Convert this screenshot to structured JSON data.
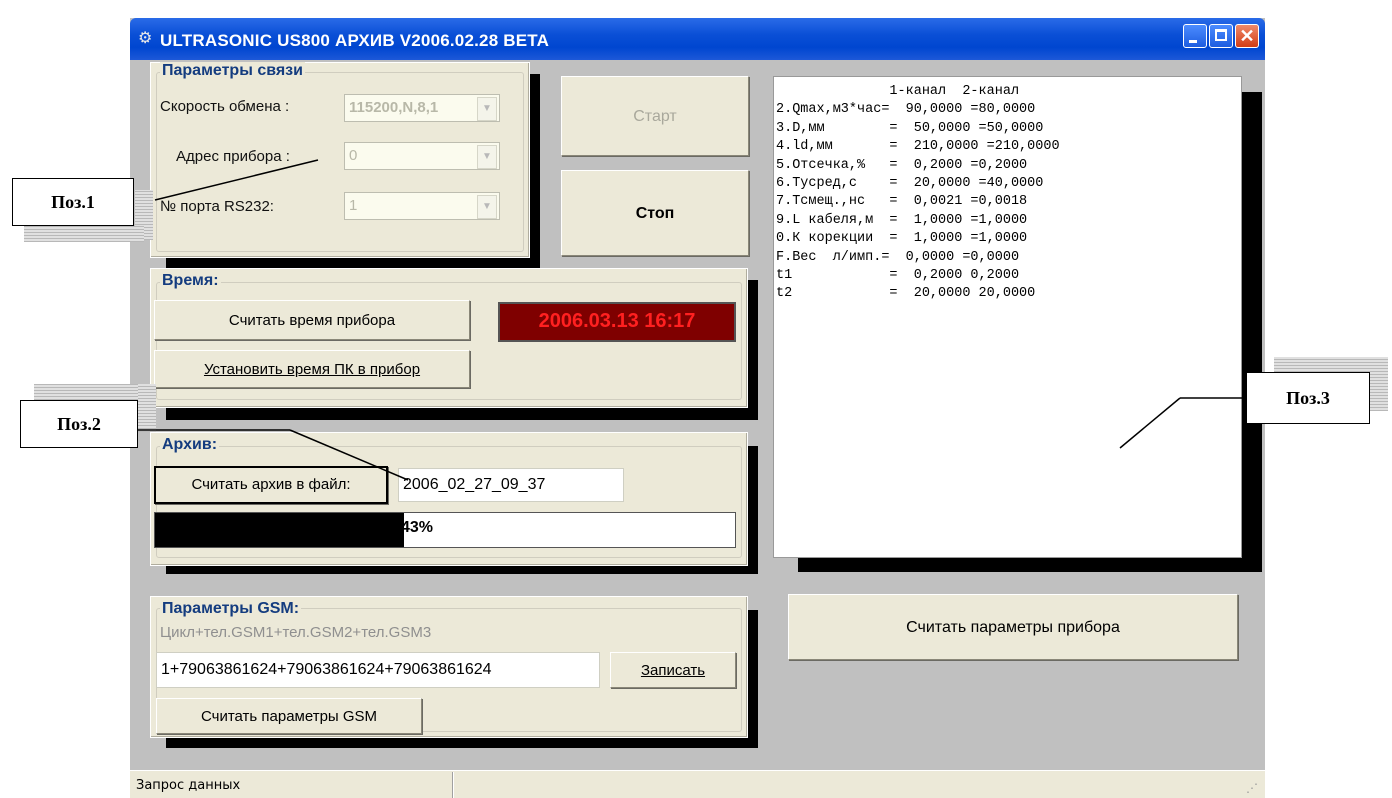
{
  "window": {
    "title": "ULTRASONIC US800 АРХИВ V2006.02.28 BETA",
    "controls": [
      "minimize",
      "maximize",
      "close"
    ]
  },
  "connection": {
    "legend": "Параметры связи",
    "baud_label": "Скорость обмена :",
    "baud_value": "115200,N,8,1",
    "address_label": "Адрес прибора :",
    "address_value": "0",
    "port_label": "№ порта RS232:",
    "port_value": "1"
  },
  "buttons": {
    "start": "Старт",
    "stop": "Стоп",
    "read_params": "Считать параметры прибора"
  },
  "time": {
    "legend": "Время:",
    "read_button": "Считать время прибора",
    "set_button": "Установить время ПК в прибор",
    "clock": "2006.03.13 16:17"
  },
  "archive": {
    "legend": "Архив:",
    "read_button": "Считать архив в файл:",
    "filename": "2006_02_27_09_37",
    "progress_percent": 43,
    "progress_text": "43%"
  },
  "gsm": {
    "legend": "Параметры GSM:",
    "hint": "Цикл+тел.GSM1+тел.GSM2+тел.GSM3",
    "value": "1+79063861624+79063861624+79063861624",
    "write_button": "Записать",
    "read_button": "Считать параметры GSM"
  },
  "params_text": [
    "              1-канал  2-канал",
    "2.Qmax,м3*час=  90,0000 =80,0000",
    "3.D,мм        =  50,0000 =50,0000",
    "4.ld,мм       =  210,0000 =210,0000",
    "5.Отсечка,%   =  0,2000 =0,2000",
    "6.Тусред,с    =  20,0000 =40,0000",
    "7.Тсмещ.,нс   =  0,0021 =0,0018",
    "9.L кабеля,м  =  1,0000 =1,0000",
    "0.К корекции  =  1,0000 =1,0000",
    "F.Вес  л/имп.=  0,0000 =0,0000",
    "t1            =  0,2000 0,2000",
    "t2            =  20,0000 20,0000"
  ],
  "status": {
    "text": "Запрос данных"
  },
  "callouts": {
    "pos1": "Поз.1",
    "pos2": "Поз.2",
    "pos3": "Поз.3"
  },
  "colors": {
    "title_bar": "#0a4fd6",
    "panel": "#ece9d8",
    "legend_text": "#143c7f",
    "clock_bg": "#7f0000",
    "clock_text": "#ff2020"
  }
}
